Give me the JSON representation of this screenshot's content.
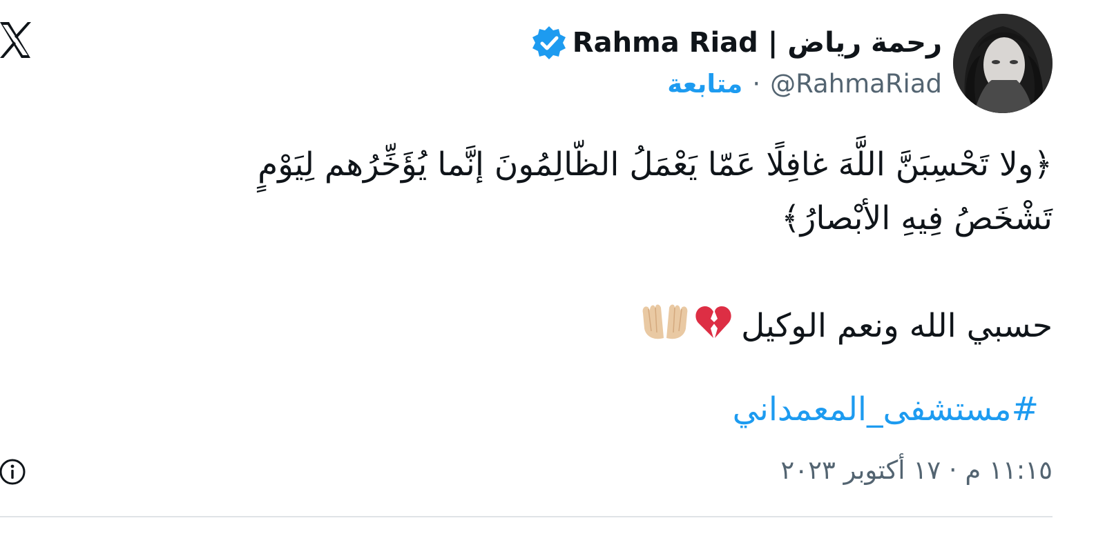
{
  "tweet": {
    "author": {
      "display_name": "رحمة رياض | Rahma Riad",
      "handle": "@RahmaRiad",
      "separator": "·",
      "follow_label": "متابعة",
      "verified": true
    },
    "body": {
      "paragraph_1_line_1": "﴿ولا تَحْسِبَنَّ اللَّهَ غافِلًا عَمّا يَعْمَلُ الظّالِمُونَ إنَّما يُؤَخِّرُهم لِيَوْمٍ",
      "paragraph_1_line_2": "تَشْخَصُ فِيهِ الأبْصارُ﴾",
      "paragraph_2": "حسبي الله ونعم الوكيل",
      "hashtag": "#مستشفى_المعمداني"
    },
    "timestamp": "١١:١٥ م · ١٧ أكتوبر ٢٠٢٣"
  },
  "icons": {
    "logo": "x-logo-icon",
    "verified": "verified-badge-icon",
    "emoji_1": "broken-heart-icon",
    "emoji_2": "palms-up-together-icon",
    "info": "info-icon"
  },
  "colors": {
    "accent": "#1d9bf0",
    "text": "#0f1419",
    "muted": "#536471",
    "divider": "#dfe3e6"
  }
}
